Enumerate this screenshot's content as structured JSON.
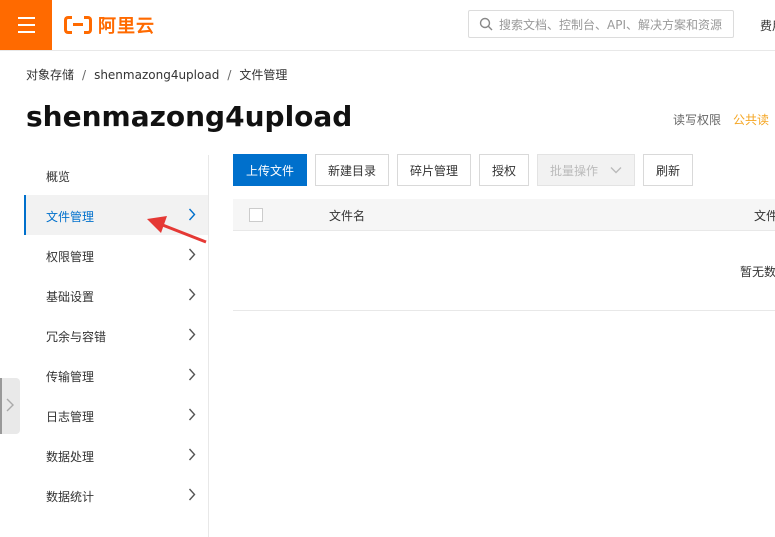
{
  "topbar": {
    "logo_text": "阿里云",
    "search_placeholder": "搜索文档、控制台、API、解决方案和资源",
    "right_text": "费用"
  },
  "breadcrumb": [
    "对象存储",
    "shenmazong4upload",
    "文件管理"
  ],
  "page_title": "shenmazong4upload",
  "permission": {
    "label": "读写权限",
    "value": "公共读"
  },
  "sidebar": {
    "items": [
      {
        "label": "概览",
        "has_chevron": false
      },
      {
        "label": "文件管理",
        "has_chevron": true,
        "active": true
      },
      {
        "label": "权限管理",
        "has_chevron": true
      },
      {
        "label": "基础设置",
        "has_chevron": true
      },
      {
        "label": "冗余与容错",
        "has_chevron": true
      },
      {
        "label": "传输管理",
        "has_chevron": true
      },
      {
        "label": "日志管理",
        "has_chevron": true
      },
      {
        "label": "数据处理",
        "has_chevron": true
      },
      {
        "label": "数据统计",
        "has_chevron": true
      }
    ]
  },
  "toolbar": {
    "upload": "上传文件",
    "new_dir": "新建目录",
    "fragments": "碎片管理",
    "authorize": "授权",
    "batch": "批量操作",
    "refresh": "刷新"
  },
  "table": {
    "columns": [
      "文件名",
      "文件"
    ],
    "empty_text": "暂无数"
  },
  "colors": {
    "brand": "#ff6a00",
    "primary": "#0070cc",
    "arrow": "#e53935",
    "public_read": "#f5a623"
  },
  "icons": [
    "menu-icon",
    "aliyun-logo-icon",
    "search-icon",
    "chevron-right-icon",
    "chevron-down-icon",
    "annotation-arrow"
  ]
}
